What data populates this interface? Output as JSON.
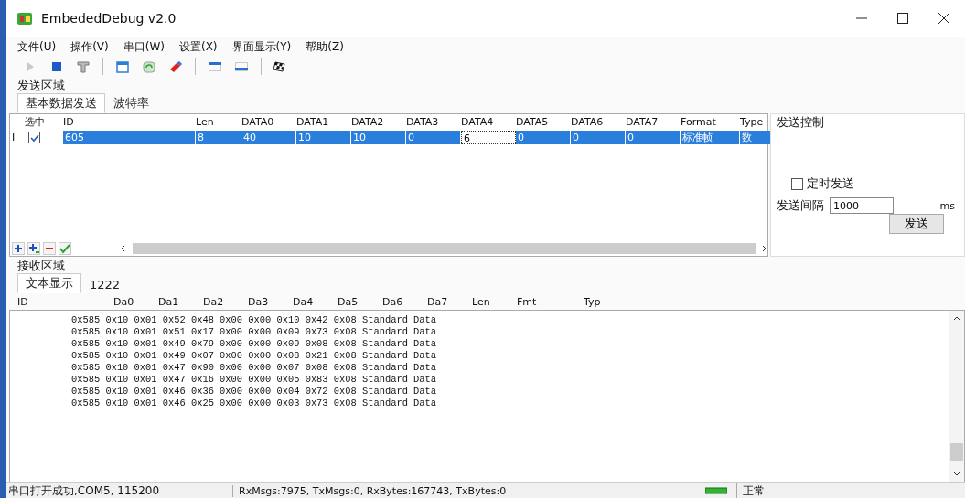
{
  "window": {
    "title": "EmbededDebug v2.0"
  },
  "menu": [
    "文件(U)",
    "操作(V)",
    "串口(W)",
    "设置(X)",
    "界面显示(Y)",
    "帮助(Z)"
  ],
  "toolbar": [
    {
      "kind": "play",
      "disabled": true
    },
    {
      "kind": "stop",
      "disabled": false
    },
    {
      "kind": "hammer",
      "disabled": false
    },
    {
      "kind": "sep"
    },
    {
      "kind": "notepad",
      "disabled": false
    },
    {
      "kind": "recycle",
      "disabled": false
    },
    {
      "kind": "eraser",
      "disabled": false
    },
    {
      "kind": "sep"
    },
    {
      "kind": "paneltop",
      "disabled": false
    },
    {
      "kind": "panelbottom",
      "disabled": false
    },
    {
      "kind": "sep"
    },
    {
      "kind": "flag",
      "disabled": false
    }
  ],
  "send": {
    "label": "发送区域",
    "tabs": [
      {
        "label": "基本数据发送",
        "selected": true
      },
      {
        "label": "波特率",
        "selected": false
      }
    ],
    "check_column": "选中",
    "columns": [
      "ID",
      "Len",
      "DATA0",
      "DATA1",
      "DATA2",
      "DATA3",
      "DATA4",
      "DATA5",
      "DATA6",
      "DATA7",
      "Format",
      "Type"
    ],
    "rows": [
      {
        "marker": "I",
        "checked": true,
        "selected": true,
        "cells": [
          {
            "text": "605",
            "editing": false
          },
          {
            "text": "8",
            "editing": false
          },
          {
            "text": "40",
            "editing": false
          },
          {
            "text": "10",
            "editing": false
          },
          {
            "text": "10",
            "editing": false
          },
          {
            "text": "0",
            "editing": false
          },
          {
            "text": "6",
            "editing": true
          },
          {
            "text": "0",
            "editing": false
          },
          {
            "text": "0",
            "editing": false
          },
          {
            "text": "0",
            "editing": false
          },
          {
            "text": "标准帧",
            "editing": false
          },
          {
            "text": "数",
            "editing": false
          }
        ]
      }
    ],
    "row_tools": [
      {
        "kind": "add"
      },
      {
        "kind": "add-sub"
      },
      {
        "kind": "remove"
      },
      {
        "kind": "check"
      }
    ],
    "control": {
      "title": "发送控制",
      "timed_label": "定时发送",
      "timed": false,
      "interval_label": "发送间隔",
      "interval": "1000",
      "unit": "ms",
      "button": "发送"
    }
  },
  "receive": {
    "label": "接收区域",
    "tabs": [
      {
        "label": "文本显示",
        "selected": true
      },
      {
        "label": "1222",
        "selected": false
      }
    ],
    "columns": [
      "ID",
      "Da0",
      "Da1",
      "Da2",
      "Da3",
      "Da4",
      "Da5",
      "Da6",
      "Da7",
      "Len",
      "Fmt",
      "Typ"
    ],
    "lines": [
      "0x585 0x10 0x01 0x52 0x48 0x00 0x00 0x10 0x42 0x08 Standard Data",
      "0x585 0x10 0x01 0x51 0x17 0x00 0x00 0x09 0x73 0x08 Standard Data",
      "0x585 0x10 0x01 0x49 0x79 0x00 0x00 0x09 0x08 0x08 Standard Data",
      "0x585 0x10 0x01 0x49 0x07 0x00 0x00 0x08 0x21 0x08 Standard Data",
      "0x585 0x10 0x01 0x47 0x90 0x00 0x00 0x07 0x08 0x08 Standard Data",
      "0x585 0x10 0x01 0x47 0x16 0x00 0x00 0x05 0x83 0x08 Standard Data",
      "0x585 0x10 0x01 0x46 0x36 0x00 0x00 0x04 0x72 0x08 Standard Data",
      "0x585 0x10 0x01 0x46 0x25 0x00 0x00 0x03 0x73 0x08 Standard Data"
    ]
  },
  "status_bar": {
    "port": "串口打开成功,COM5, 115200",
    "counters": "RxMsgs:7975, TxMsgs:0, RxBytes:167743, TxBytes:0",
    "state": "正常"
  }
}
